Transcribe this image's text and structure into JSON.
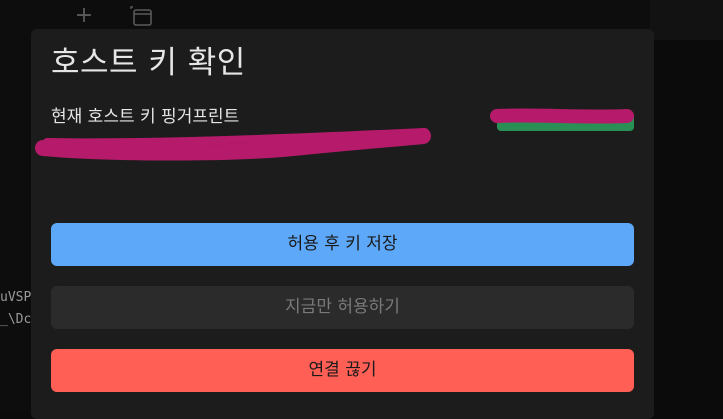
{
  "background": {
    "terminal_lines": [
      "uVSP",
      "_\\Dc"
    ],
    "colors": {
      "page": "#0b0b0b",
      "topbar": "#0d0d0d"
    }
  },
  "topbar": {
    "icons": [
      "plus-icon",
      "window-icon"
    ]
  },
  "dialog": {
    "title": "호스트 키 확인",
    "fingerprint_label": "현재 호스트 키 핑거프린트",
    "status_badge": {
      "color": "#2a8f55"
    },
    "redaction_color": "#b51b6a",
    "buttons": {
      "save": {
        "label": "허용 후 키 저장",
        "color": "#5ea8f9"
      },
      "allow_once": {
        "label": "지금만 허용하기",
        "color": "#2b2b2b"
      },
      "disconnect": {
        "label": "연결 끊기",
        "color": "#ff5f55"
      }
    },
    "colors": {
      "surface": "#1c1c1c",
      "text": "#e6e6e6"
    }
  }
}
